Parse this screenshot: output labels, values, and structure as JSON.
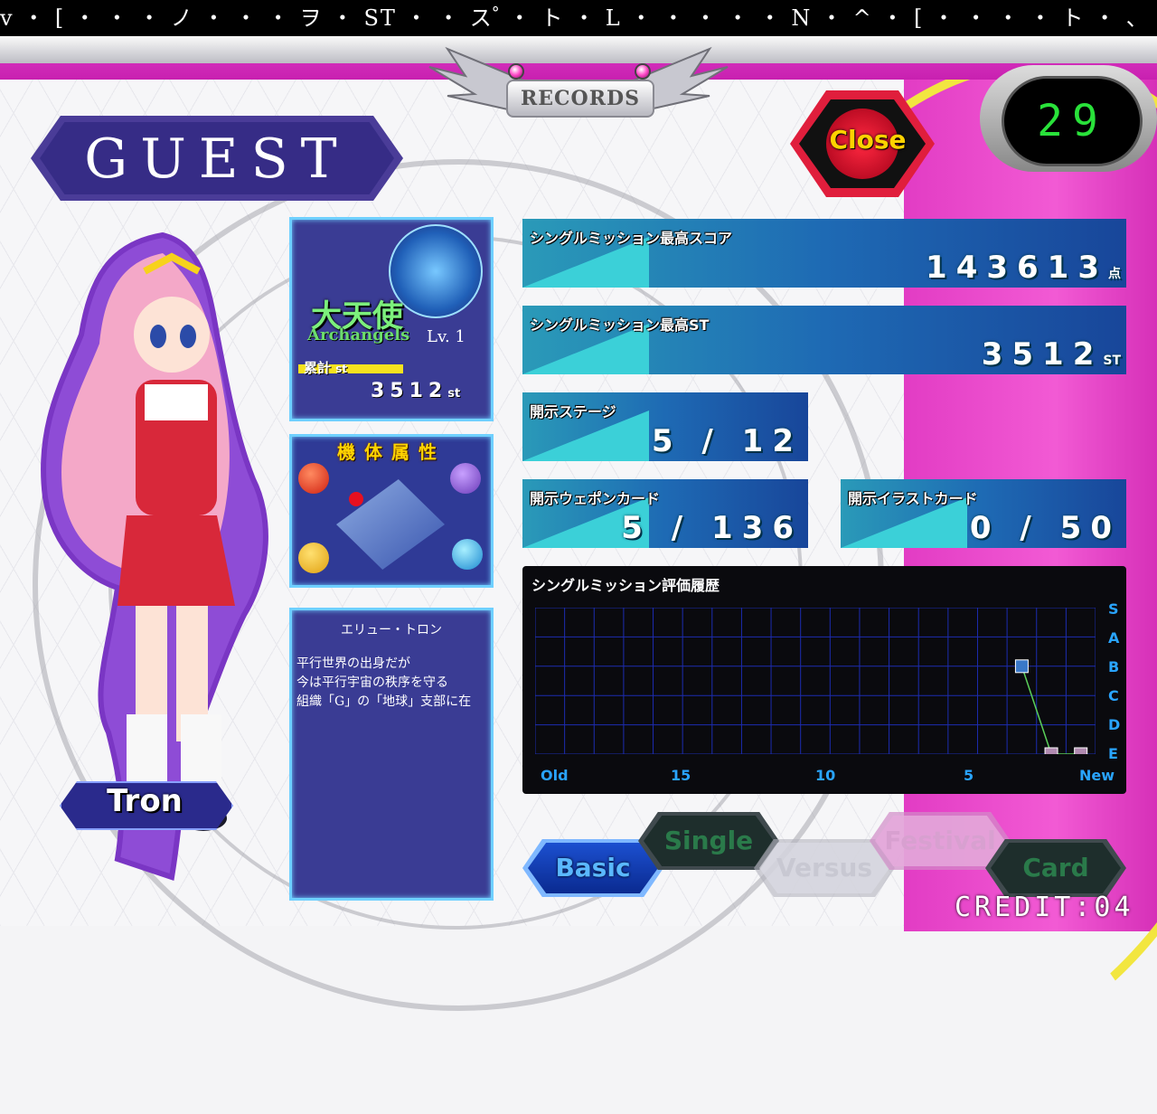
{
  "marquee": "v ・ [ ・ ・ ・ ノ ・ ・ ・ ヲ ・ ST ・ ・ ス ゚ ・ ト ・ L ・ ・ ・ ・ ・ N ・ ^ ・ [ ・ ・ ・ ・ ト ・ 、",
  "header": {
    "records_label": "RECORDS"
  },
  "player": {
    "name": "GUEST"
  },
  "timer": {
    "value": "29"
  },
  "close_label": "Close",
  "rank": {
    "title_jp": "大天使",
    "title_en": "Archangels",
    "level": "Lv. 1",
    "total_label": "累計",
    "total_unit": "st",
    "total_value": "3512"
  },
  "attribute": {
    "title": "機体属性"
  },
  "character": {
    "description_title": "エリュー・トロン",
    "description_lines": [
      "平行世界の出身だが",
      "今は平行宇宙の秩序を守る",
      "組織「G」の「地球」支部に在"
    ],
    "name": "Tron"
  },
  "stats": {
    "high_score": {
      "label": "シングルミッション最高スコア",
      "value": "143613",
      "unit": "点"
    },
    "high_st": {
      "label": "シングルミッション最高ST",
      "value": "3512",
      "unit": "ST"
    },
    "stages": {
      "label": "開示ステージ",
      "value": "5 / 12"
    },
    "weapon_cards": {
      "label": "開示ウェポンカード",
      "value": "5 / 136"
    },
    "illust_cards": {
      "label": "開示イラストカード",
      "value": "0 / 50"
    }
  },
  "chart_data": {
    "type": "line",
    "title": "シングルミッション評価履歴",
    "x_ticks": [
      "Old",
      "15",
      "10",
      "5",
      "New"
    ],
    "y_ticks": [
      "S",
      "A",
      "B",
      "C",
      "D",
      "E"
    ],
    "series": [
      {
        "x": [
          3,
          2,
          1
        ],
        "y": [
          "B",
          "E",
          "E"
        ]
      }
    ]
  },
  "tabs": [
    {
      "label": "Basic",
      "active": true
    },
    {
      "label": "Single",
      "active": false
    },
    {
      "label": "Versus",
      "active": false
    },
    {
      "label": "Festival",
      "active": false
    },
    {
      "label": "Card",
      "active": false
    }
  ],
  "credit": "CREDIT:04",
  "colors": {
    "accent_pink": "#e040c8",
    "panel_blue": "#3a3c94",
    "chart_blue": "#29a4ff",
    "timer_green": "#29e23a"
  }
}
